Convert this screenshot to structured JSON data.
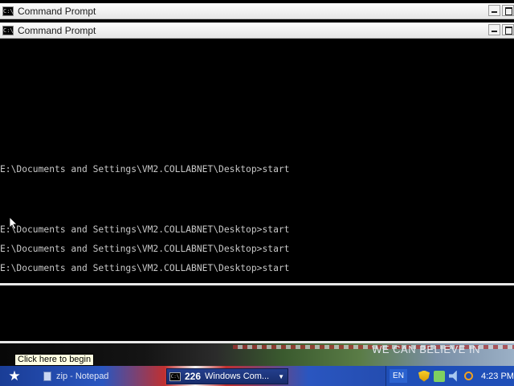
{
  "windows": {
    "back": {
      "title": "Command Prompt",
      "icon": "cmd-icon"
    },
    "front": {
      "title": "Command Prompt",
      "icon": "cmd-icon"
    }
  },
  "console": {
    "lines": [
      "E:\\Documents and Settings\\VM2.COLLABNET\\Desktop>start",
      "E:\\Documents and Settings\\VM2.COLLABNET\\Desktop>start",
      "E:\\Documents and Settings\\VM2.COLLABNET\\Desktop>start",
      "E:\\Documents and Settings\\VM2.COLLABNET\\Desktop>start"
    ]
  },
  "tooltip": "Click here to begin",
  "banner": {
    "slogan": "WE CAN BELIEVE IN"
  },
  "taskbar": {
    "notepad_label": "zip - Notepad",
    "cmd_group": {
      "count": "226",
      "label": "Windows Com..."
    },
    "language": "EN",
    "clock": "4:23 PM"
  },
  "icons": {
    "start": "star-icon",
    "window": "cmd-icon",
    "tray": [
      "shield-icon",
      "network-icon",
      "volume-icon",
      "search-icon"
    ]
  },
  "colors": {
    "console_bg": "#000000",
    "console_text": "#c8c8c8",
    "taskbar_blue": "#2a56c0",
    "tooltip_bg": "#ffffe1"
  }
}
